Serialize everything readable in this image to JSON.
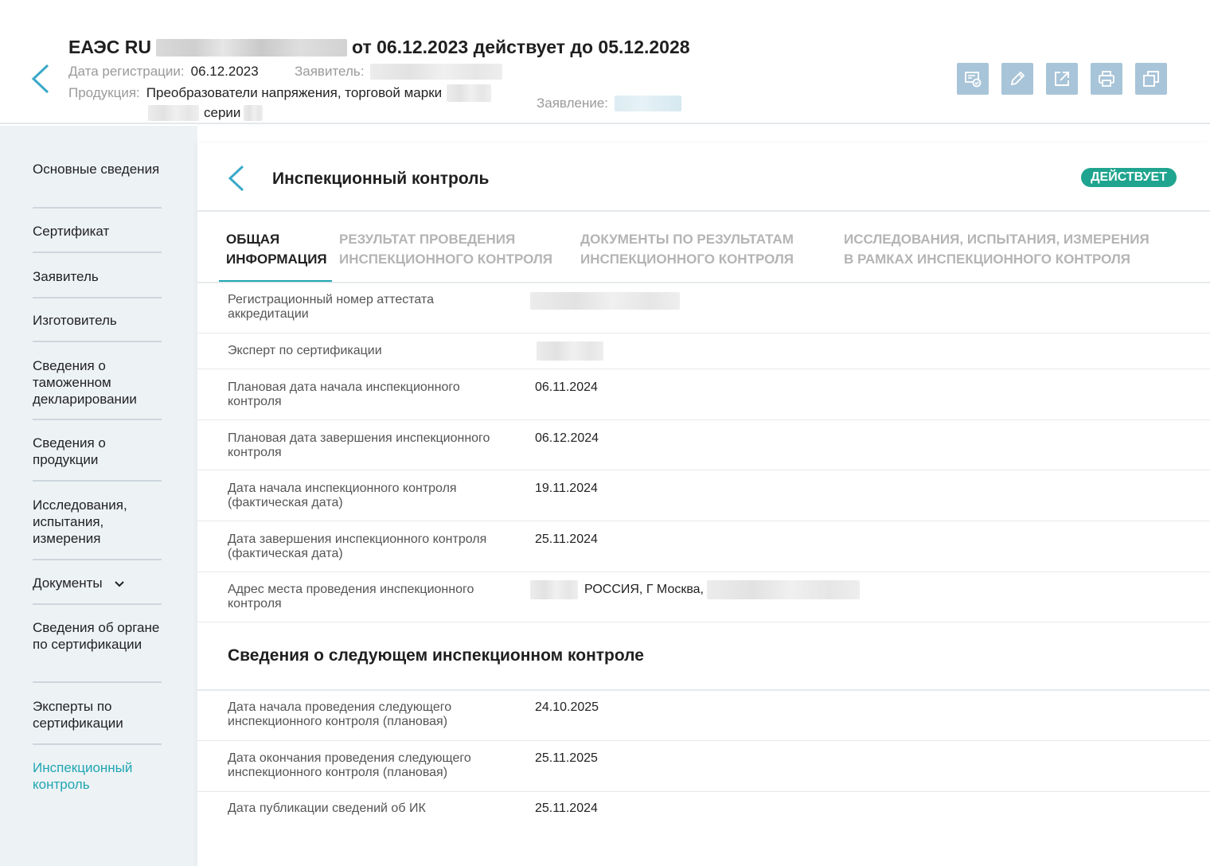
{
  "header": {
    "title_prefix": "ЕАЭС RU",
    "title_suffix": "от 06.12.2023 действует до 05.12.2028",
    "reg_date_label": "Дата регистрации:",
    "reg_date_value": "06.12.2023",
    "applicant_label": "Заявитель:",
    "product_label": "Продукция:",
    "product_value": "Преобразователи напряжения, торговой марки",
    "series_text": "серии",
    "statement_label": "Заявление:"
  },
  "toolbar": {
    "icons": [
      "certificate-check-icon",
      "edit-pencil-icon",
      "open-external-icon",
      "print-icon",
      "copy-icon"
    ],
    "button_color": "#a8c4d8"
  },
  "sidebar": {
    "items": [
      {
        "label": "Основные сведения"
      },
      {
        "label": "Сертификат"
      },
      {
        "label": "Заявитель"
      },
      {
        "label": "Изготовитель"
      },
      {
        "label": "Сведения о таможенном декларировании"
      },
      {
        "label": "Сведения о продукции"
      },
      {
        "label": "Исследования, испытания, измерения"
      },
      {
        "label": "Документы"
      },
      {
        "label": "Сведения об органе по сертификации"
      },
      {
        "label": "Эксперты по сертификации"
      },
      {
        "label": "Инспекционный контроль"
      }
    ],
    "active_color": "#1fa6b2"
  },
  "panel": {
    "title": "Инспекционный контроль",
    "status": "ДЕЙСТВУЕТ",
    "status_color": "#1fa48f",
    "tabs": [
      {
        "label": "Общая информация"
      },
      {
        "label": "Результат проведения инспекционного контроля"
      },
      {
        "label": "Документы по результатам инспекционного контроля"
      },
      {
        "label": "Исследования, испытания, измерения в рамках инспекционного контроля"
      }
    ],
    "rows": [
      {
        "label": "Регистрационный номер аттестата аккредитации",
        "value": ""
      },
      {
        "label": "Эксперт по сертификации",
        "value": ""
      },
      {
        "label": "Плановая дата начала инспекционного контроля",
        "value": "06.11.2024"
      },
      {
        "label": "Плановая дата завершения инспекционного контроля",
        "value": "06.12.2024"
      },
      {
        "label": "Дата начала инспекционного контроля (фактическая дата)",
        "value": "19.11.2024"
      },
      {
        "label": "Дата завершения инспекционного контроля (фактическая дата)",
        "value": "25.11.2024"
      },
      {
        "label": "Адрес места проведения инспекционного контроля",
        "value": "РОССИЯ, Г Москва,"
      }
    ],
    "next_section_title": "Сведения о следующем инспекционном контроле",
    "next_rows": [
      {
        "label": "Дата начала проведения следующего инспекционного контроля (плановая)",
        "value": "24.10.2025"
      },
      {
        "label": "Дата окончания проведения следующего инспекционного контроля (плановая)",
        "value": "25.11.2025"
      },
      {
        "label": "Дата публикации сведений об ИК",
        "value": "25.11.2024"
      }
    ]
  }
}
